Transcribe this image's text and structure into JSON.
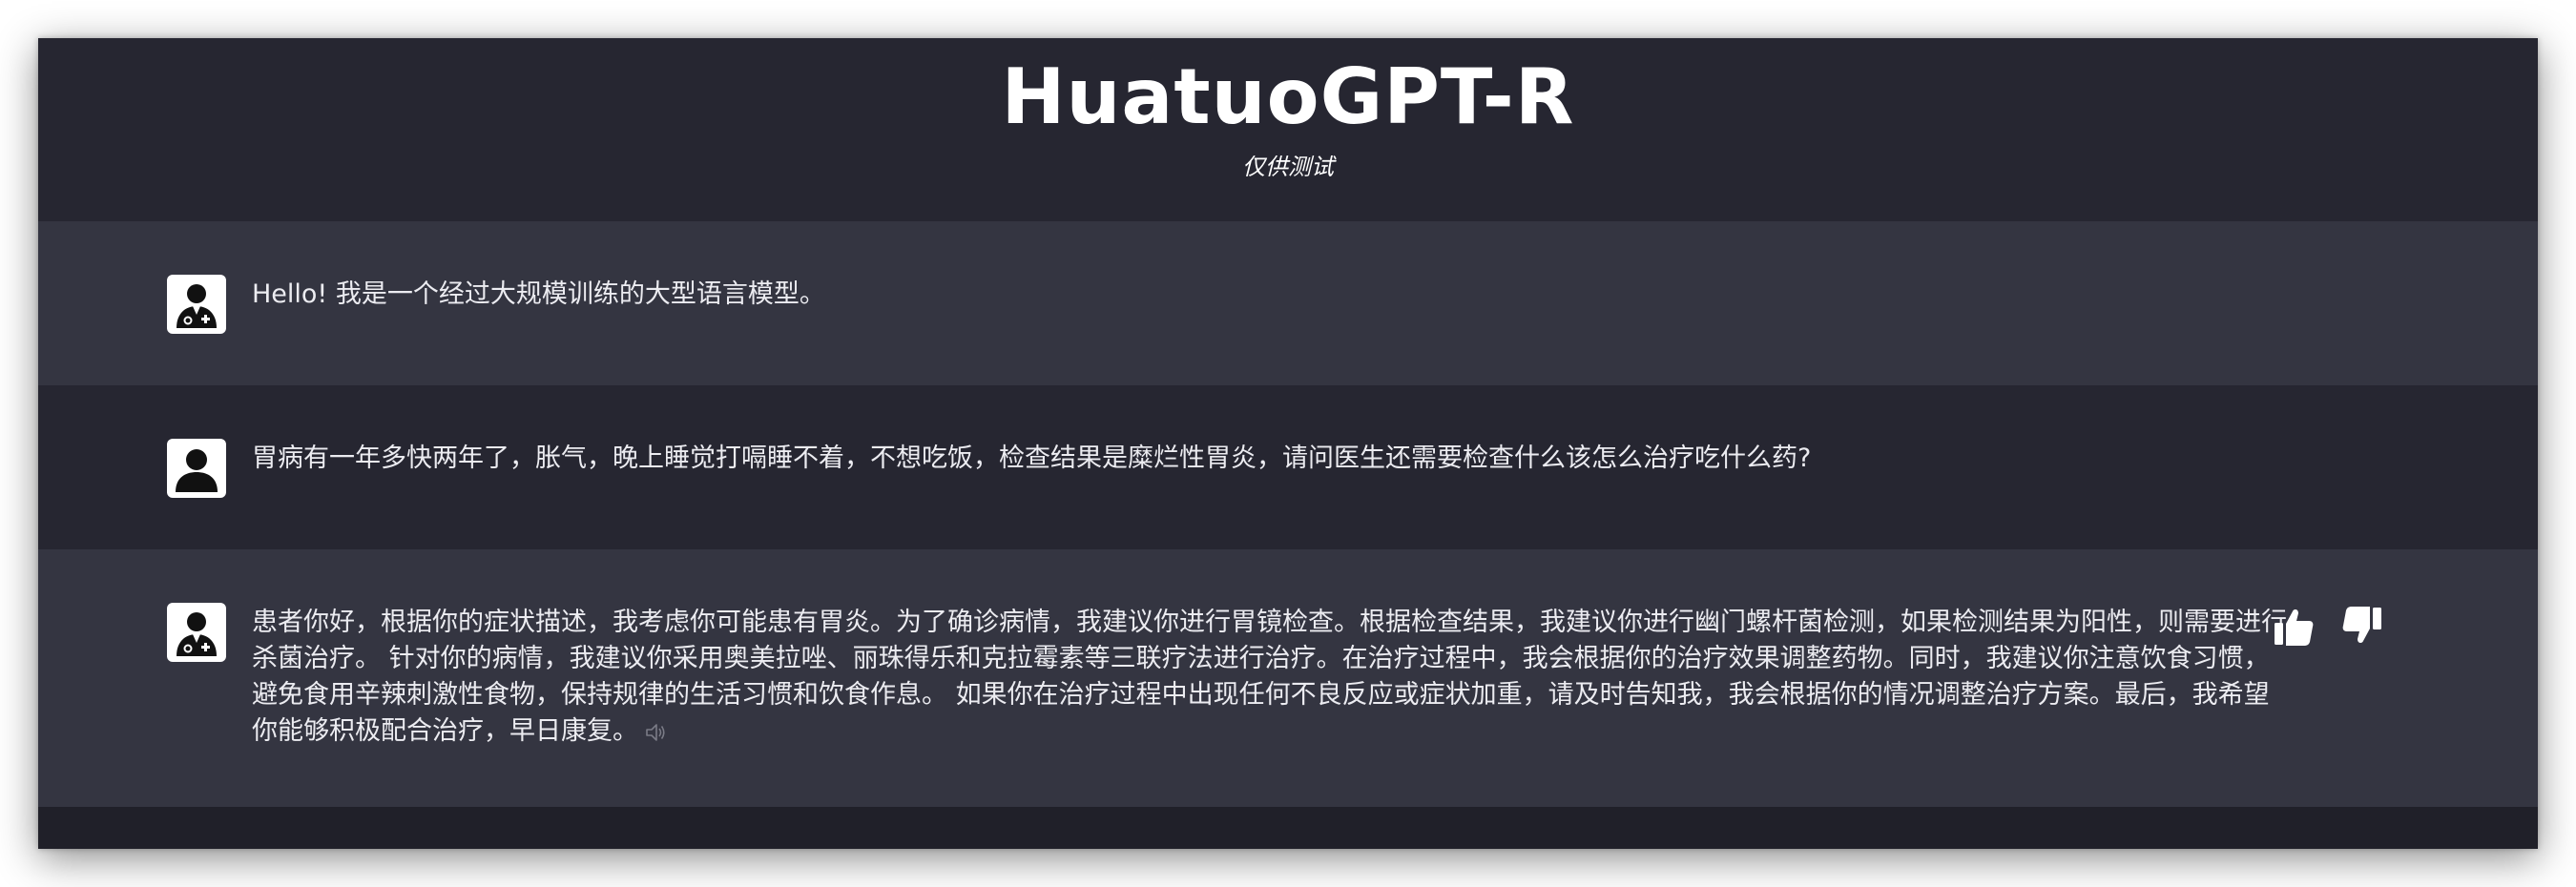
{
  "header": {
    "title": "HuatuoGPT-R",
    "subtitle": "仅供测试"
  },
  "messages": [
    {
      "role": "assistant",
      "avatar_icon": "doctor-icon",
      "text": "Hello! 我是一个经过大规模训练的大型语言模型。"
    },
    {
      "role": "user",
      "avatar_icon": "user-icon",
      "text": "胃病有一年多快两年了，胀气，晚上睡觉打嗝睡不着，不想吃饭，检查结果是糜烂性胃炎，请问医生还需要检查什么该怎么治疗吃什么药?"
    },
    {
      "role": "assistant",
      "avatar_icon": "doctor-icon",
      "text": "患者你好，根据你的症状描述，我考虑你可能患有胃炎。为了确诊病情，我建议你进行胃镜检查。根据检查结果，我建议你进行幽门螺杆菌检测，如果检测结果为阳性，则需要进行杀菌治疗。 针对你的病情，我建议你采用奥美拉唑、丽珠得乐和克拉霉素等三联疗法进行治疗。在治疗过程中，我会根据你的治疗效果调整药物。同时，我建议你注意饮食习惯，避免食用辛辣刺激性食物，保持规律的生活习惯和饮食作息。 如果你在治疗过程中出现任何不良反应或症状加重，请及时告知我，我会根据你的情况调整治疗方案。最后，我希望你能够积极配合治疗，早日康复。",
      "actions": [
        "thumbs-up-icon",
        "thumbs-down-icon",
        "speaker-icon"
      ]
    }
  ],
  "colors": {
    "window_bg": "#202029",
    "header_bg": "#262631",
    "bot_row_bg": "#343541",
    "user_row_bg": "#262631",
    "text": "#ececf1"
  }
}
